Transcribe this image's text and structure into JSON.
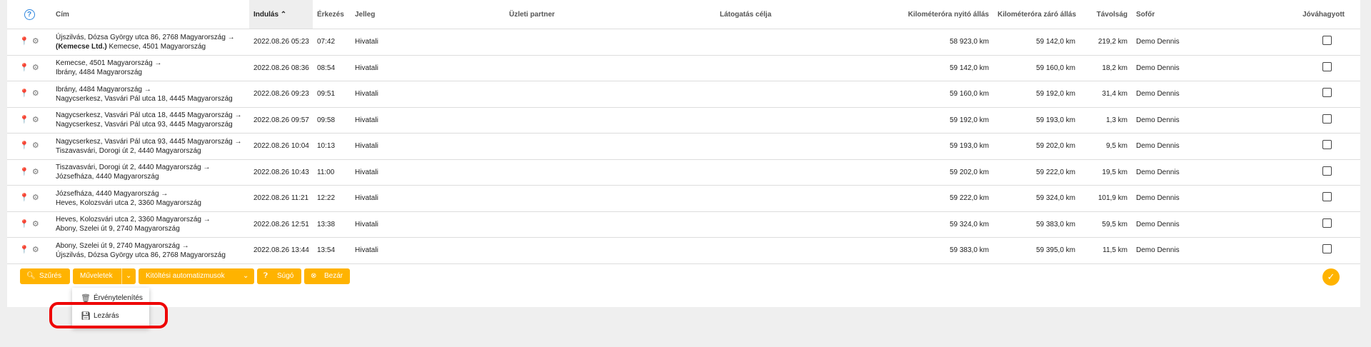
{
  "colors": {
    "accent": "#ffb300",
    "help": "#2e86de",
    "highlight": "#ee0000"
  },
  "columns": {
    "cim": "Cím",
    "indulas": "Indulás",
    "erkezes": "Érkezés",
    "jelleg": "Jelleg",
    "partner": "Üzleti partner",
    "celja": "Látogatás célja",
    "nyito": "Kilométeróra nyitó állás",
    "zaro": "Kilométeróra záró állás",
    "tavolsag": "Távolság",
    "sofor": "Sofőr",
    "jovahagyott": "Jóváhagyott"
  },
  "rows": [
    {
      "addr1": "Újszilvás, Dózsa György utca 86, 2768 Magyarország →",
      "addr2_bold": "(Kemecse Ltd.)",
      "addr2": "Kemecse, 4501 Magyarország",
      "start": "2022.08.26 05:23",
      "end": "07:42",
      "type": "Hivatali",
      "open": "58 923,0 km",
      "close": "59 142,0 km",
      "dist": "219,2 km",
      "driver": "Demo Dennis"
    },
    {
      "addr1": "Kemecse, 4501 Magyarország →",
      "addr2_bold": "",
      "addr2": "Ibrány, 4484 Magyarország",
      "start": "2022.08.26 08:36",
      "end": "08:54",
      "type": "Hivatali",
      "open": "59 142,0 km",
      "close": "59 160,0 km",
      "dist": "18,2 km",
      "driver": "Demo Dennis"
    },
    {
      "addr1": "Ibrány, 4484 Magyarország →",
      "addr2_bold": "",
      "addr2": "Nagycserkesz, Vasvári Pál utca 18, 4445 Magyarország",
      "start": "2022.08.26 09:23",
      "end": "09:51",
      "type": "Hivatali",
      "open": "59 160,0 km",
      "close": "59 192,0 km",
      "dist": "31,4 km",
      "driver": "Demo Dennis"
    },
    {
      "addr1": "Nagycserkesz, Vasvári Pál utca 18, 4445 Magyarország →",
      "addr2_bold": "",
      "addr2": "Nagycserkesz, Vasvári Pál utca 93, 4445 Magyarország",
      "start": "2022.08.26 09:57",
      "end": "09:58",
      "type": "Hivatali",
      "open": "59 192,0 km",
      "close": "59 193,0 km",
      "dist": "1,3 km",
      "driver": "Demo Dennis"
    },
    {
      "addr1": "Nagycserkesz, Vasvári Pál utca 93, 4445 Magyarország →",
      "addr2_bold": "",
      "addr2": "Tiszavasvári, Dorogi út 2, 4440 Magyarország",
      "start": "2022.08.26 10:04",
      "end": "10:13",
      "type": "Hivatali",
      "open": "59 193,0 km",
      "close": "59 202,0 km",
      "dist": "9,5 km",
      "driver": "Demo Dennis"
    },
    {
      "addr1": "Tiszavasvári, Dorogi út 2, 4440 Magyarország →",
      "addr2_bold": "",
      "addr2": "Józsefháza, 4440 Magyarország",
      "start": "2022.08.26 10:43",
      "end": "11:00",
      "type": "Hivatali",
      "open": "59 202,0 km",
      "close": "59 222,0 km",
      "dist": "19,5 km",
      "driver": "Demo Dennis"
    },
    {
      "addr1": "Józsefháza, 4440 Magyarország →",
      "addr2_bold": "",
      "addr2": "Heves, Kolozsvári utca 2, 3360 Magyarország",
      "start": "2022.08.26 11:21",
      "end": "12:22",
      "type": "Hivatali",
      "open": "59 222,0 km",
      "close": "59 324,0 km",
      "dist": "101,9 km",
      "driver": "Demo Dennis"
    },
    {
      "addr1": "Heves, Kolozsvári utca 2, 3360 Magyarország →",
      "addr2_bold": "",
      "addr2": "Abony, Szelei út 9, 2740 Magyarország",
      "start": "2022.08.26 12:51",
      "end": "13:38",
      "type": "Hivatali",
      "open": "59 324,0 km",
      "close": "59 383,0 km",
      "dist": "59,5 km",
      "driver": "Demo Dennis"
    },
    {
      "addr1": "Abony, Szelei út 9, 2740 Magyarország →",
      "addr2_bold": "",
      "addr2": "Újszilvás, Dózsa György utca 86, 2768 Magyarország",
      "start": "2022.08.26 13:44",
      "end": "13:54",
      "type": "Hivatali",
      "open": "59 383,0 km",
      "close": "59 395,0 km",
      "dist": "11,5 km",
      "driver": "Demo Dennis"
    }
  ],
  "toolbar": {
    "filter": "Szűrés",
    "actions": "Műveletek",
    "autofill": "Kitöltési automatizmusok",
    "help": "Súgó",
    "close": "Bezár"
  },
  "dropdown": {
    "invalidate": "Érvénytelenítés",
    "lock": "Lezárás"
  }
}
